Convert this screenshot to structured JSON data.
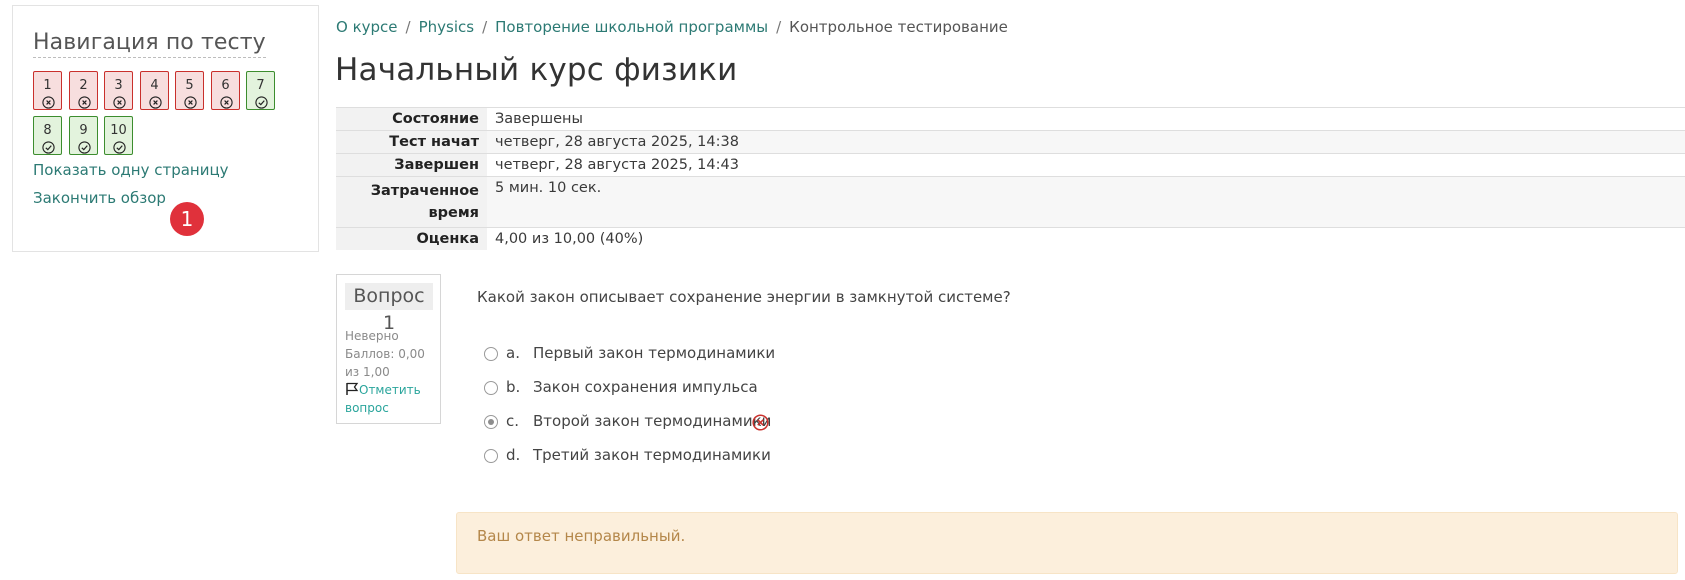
{
  "nav": {
    "title": "Навигация по тесту",
    "questions": [
      {
        "label": "1",
        "status": "incorrect"
      },
      {
        "label": "2",
        "status": "incorrect"
      },
      {
        "label": "3",
        "status": "incorrect"
      },
      {
        "label": "4",
        "status": "incorrect"
      },
      {
        "label": "5",
        "status": "incorrect"
      },
      {
        "label": "6",
        "status": "incorrect"
      },
      {
        "label": "7",
        "status": "correct"
      },
      {
        "label": "8",
        "status": "correct"
      },
      {
        "label": "9",
        "status": "correct"
      },
      {
        "label": "10",
        "status": "correct"
      }
    ],
    "show_one_page": "Показать одну страницу",
    "finish_review": "Закончить обзор",
    "badge": "1"
  },
  "breadcrumb": {
    "items": [
      "О курсе",
      "Physics",
      "Повторение школьной программы",
      "Контрольное тестирование"
    ],
    "separator": "/"
  },
  "page_title": "Начальный курс физики",
  "summary": {
    "rows": [
      {
        "key": "Состояние",
        "value": "Завершены"
      },
      {
        "key": "Тест начат",
        "value": "четверг, 28 августа 2025, 14:38"
      },
      {
        "key": "Завершен",
        "value": "четверг, 28 августа 2025, 14:43"
      },
      {
        "key": "Затраченное время",
        "value": "5 мин. 10 сек."
      },
      {
        "key": "Оценка",
        "value": "4,00 из 10,00 (40%)"
      }
    ]
  },
  "question": {
    "number_label": "Вопрос 1",
    "status": "Неверно",
    "score": "Баллов: 0,00 из 1,00",
    "flag_label": "Отметить вопрос",
    "text": "Какой закон описывает сохранение энергии в замкнутой системе?",
    "answers": [
      {
        "letter": "a.",
        "text": "Первый закон термодинамики",
        "selected": false
      },
      {
        "letter": "b.",
        "text": "Закон сохранения импульса",
        "selected": false
      },
      {
        "letter": "c.",
        "text": "Второй закон термодинамики",
        "selected": true
      },
      {
        "letter": "d.",
        "text": "Третий закон термодинамики",
        "selected": false
      }
    ],
    "feedback": "Ваш ответ неправильный."
  },
  "colors": {
    "link": "#2c7a74",
    "incorrect_bg": "#f7dede",
    "incorrect_border": "#c9302c",
    "correct_bg": "#e3f3dd",
    "correct_border": "#3c8d2e",
    "badge": "#e0313b",
    "feedback_bg": "#fcefdc",
    "feedback_text": "#b4874a"
  },
  "icons": {
    "incorrect": "x-circle-icon",
    "correct": "check-circle-icon",
    "flag": "flag-icon"
  }
}
